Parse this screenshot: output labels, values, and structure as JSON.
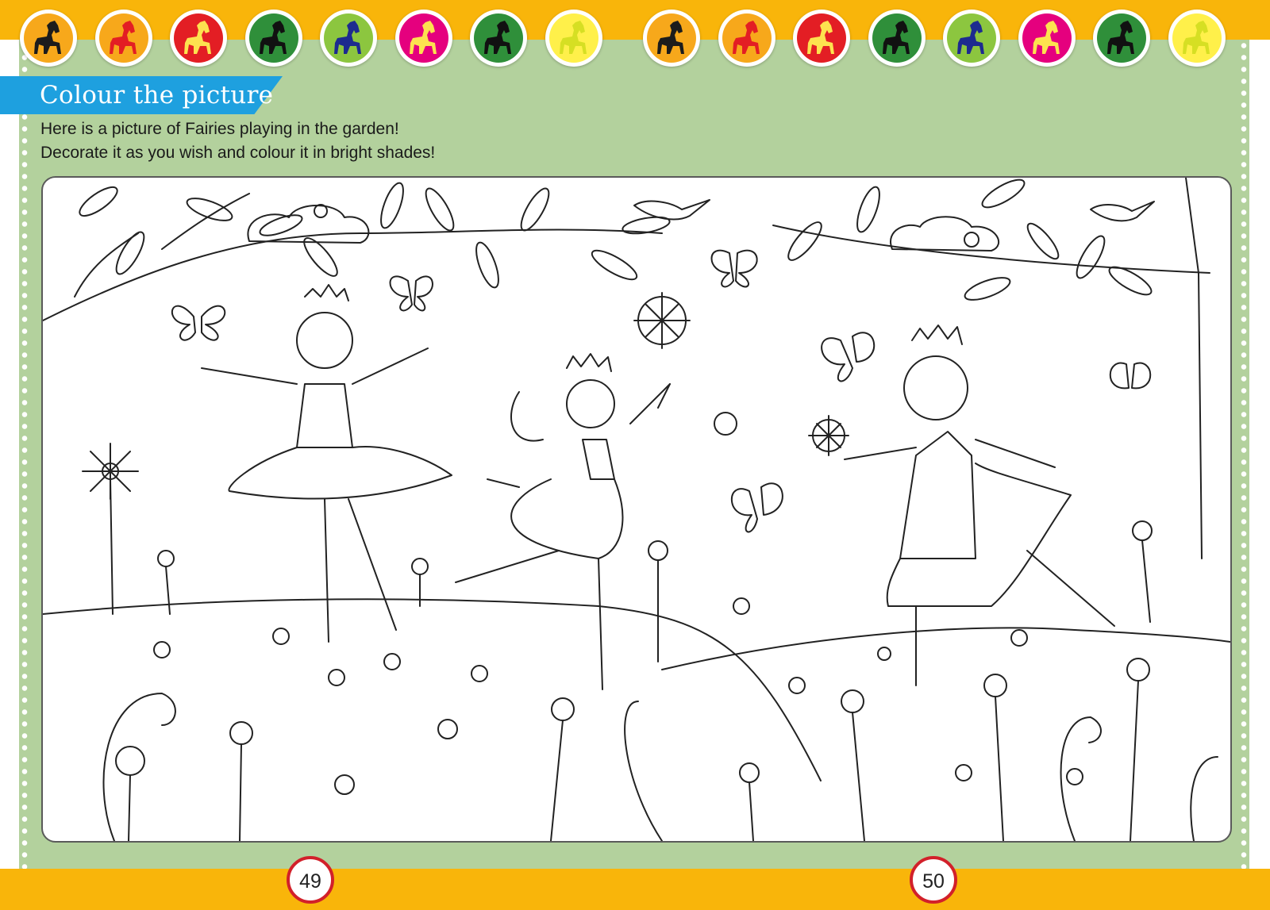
{
  "activity": {
    "title": "Colour the picture",
    "instructions": [
      "Here is a picture of Fairies playing in the garden!",
      "Decorate it as you wish and colour it in bright shades!"
    ]
  },
  "colors": {
    "band": "#f9b50a",
    "panel": "#b3d19d",
    "ribbon": "#1ea0df",
    "page_number_ring": "#d2202a"
  },
  "horse_icons": [
    {
      "icon": "horse-icon",
      "disc": "#f7a81b",
      "horse": "#1c1c1c"
    },
    {
      "icon": "horse-icon",
      "disc": "#f7a81b",
      "horse": "#e31e24"
    },
    {
      "icon": "horse-icon",
      "disc": "#e31e24",
      "horse": "#fde24f"
    },
    {
      "icon": "horse-icon",
      "disc": "#2f8f3a",
      "horse": "#111111"
    },
    {
      "icon": "horse-icon",
      "disc": "#8cc63f",
      "horse": "#1d2b8f"
    },
    {
      "icon": "horse-icon",
      "disc": "#e5007e",
      "horse": "#fde24f"
    },
    {
      "icon": "horse-icon",
      "disc": "#2f8f3a",
      "horse": "#111111"
    },
    {
      "icon": "horse-icon",
      "disc": "#fff04a",
      "horse": "#d6df23"
    },
    {
      "icon": "horse-icon",
      "disc": "#f7a81b",
      "horse": "#1c1c1c"
    },
    {
      "icon": "horse-icon",
      "disc": "#f7a81b",
      "horse": "#e31e24"
    },
    {
      "icon": "horse-icon",
      "disc": "#e31e24",
      "horse": "#fde24f"
    },
    {
      "icon": "horse-icon",
      "disc": "#2f8f3a",
      "horse": "#111111"
    },
    {
      "icon": "horse-icon",
      "disc": "#8cc63f",
      "horse": "#1d2b8f"
    },
    {
      "icon": "horse-icon",
      "disc": "#e5007e",
      "horse": "#fde24f"
    },
    {
      "icon": "horse-icon",
      "disc": "#2f8f3a",
      "horse": "#111111"
    },
    {
      "icon": "horse-icon",
      "disc": "#fff04a",
      "horse": "#d6df23"
    }
  ],
  "page_numbers": {
    "left": "49",
    "right": "50"
  }
}
